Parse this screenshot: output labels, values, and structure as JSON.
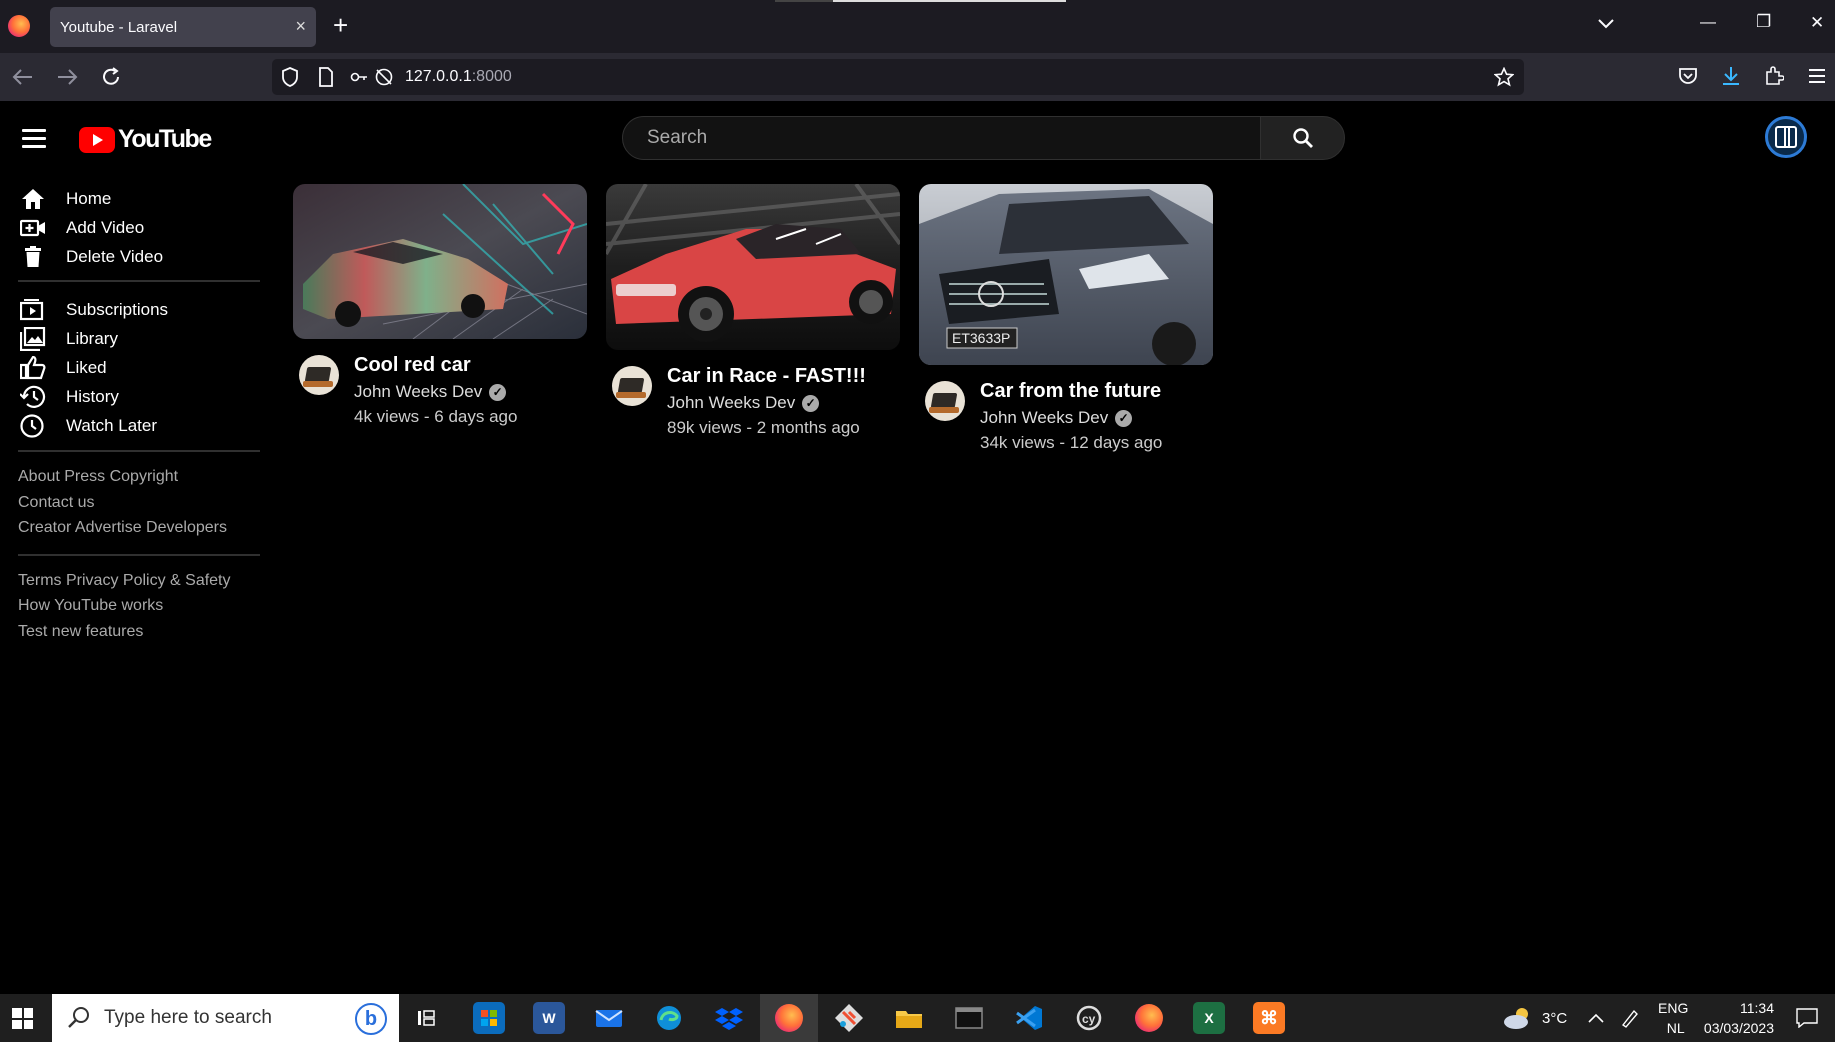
{
  "browser": {
    "tab_title": "Youtube - Laravel",
    "tab_close": "×",
    "new_tab": "+",
    "url_host": "127.0.0.1",
    "url_port": ":8000",
    "window_controls": {
      "minimize": "—",
      "restore": "❐",
      "close": "✕"
    },
    "nav_icons": [
      "back-arrow-icon",
      "forward-arrow-icon",
      "reload-icon"
    ]
  },
  "header": {
    "logo_text": "YouTube",
    "search_placeholder": "Search"
  },
  "sidebar": {
    "primary": [
      {
        "label": "Home",
        "icon": "home-icon"
      },
      {
        "label": "Add Video",
        "icon": "add-video-icon"
      },
      {
        "label": "Delete Video",
        "icon": "trash-icon"
      }
    ],
    "secondary": [
      {
        "label": "Subscriptions",
        "icon": "subscriptions-icon"
      },
      {
        "label": "Library",
        "icon": "library-icon"
      },
      {
        "label": "Liked",
        "icon": "thumbs-up-icon"
      },
      {
        "label": "History",
        "icon": "history-icon"
      },
      {
        "label": "Watch Later",
        "icon": "clock-icon"
      }
    ],
    "footer1": [
      "About Press Copyright",
      "Contact us",
      "Creator Advertise Developers"
    ],
    "footer2": [
      "Terms Privacy Policy & Safety",
      "How YouTube works",
      "Test new features"
    ]
  },
  "videos": [
    {
      "title": "Cool red car",
      "channel": "John Weeks Dev",
      "stats": "4k views - 6 days ago"
    },
    {
      "title": "Car in Race - FAST!!!",
      "channel": "John Weeks Dev",
      "stats": "89k views - 2 months ago"
    },
    {
      "title": "Car from the future",
      "channel": "John Weeks Dev",
      "stats": "34k views - 12 days ago",
      "plate": "ET3633P"
    }
  ],
  "taskbar": {
    "search_placeholder": "Type here to search",
    "weather": "3°C",
    "lang_top": "ENG",
    "lang_bottom": "NL",
    "time": "11:34",
    "date": "03/03/2023",
    "apps": [
      "task-view-icon",
      "store-icon",
      "word-icon",
      "mail-icon",
      "edge-icon",
      "dropbox-icon",
      "firefox-icon",
      "git-icon",
      "file-explorer-icon",
      "terminal-icon",
      "vscode-icon",
      "cypress-icon",
      "firefox-icon",
      "excel-icon",
      "xampp-icon"
    ]
  },
  "colors": {
    "accent_red": "#ff0000",
    "background": "#000000",
    "muted_text": "#aaaaaa"
  }
}
